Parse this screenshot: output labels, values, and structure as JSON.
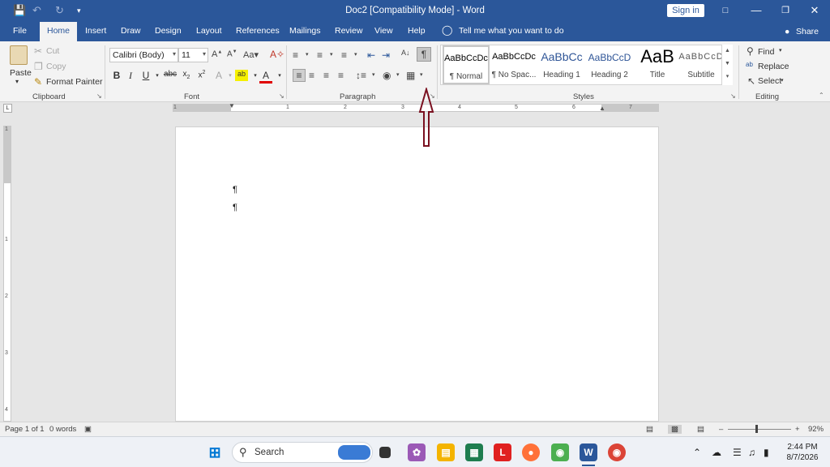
{
  "titlebar": {
    "doc_title": "Doc2 [Compatibility Mode]  -  Word",
    "signin_label": "Sign in"
  },
  "tabs": [
    "File",
    "Home",
    "Insert",
    "Draw",
    "Design",
    "Layout",
    "References",
    "Mailings",
    "Review",
    "View",
    "Help"
  ],
  "tellme": "Tell me what you want to do",
  "share_label": "Share",
  "clipboard": {
    "paste": "Paste",
    "cut": "Cut",
    "copy": "Copy",
    "format_painter": "Format Painter",
    "label": "Clipboard"
  },
  "font": {
    "name": "Calibri (Body)",
    "size": "11",
    "label": "Font"
  },
  "paragraph": {
    "label": "Paragraph"
  },
  "styles": {
    "items": [
      {
        "sample": "AaBbCcDc",
        "name": "¶ Normal"
      },
      {
        "sample": "AaBbCcDc",
        "name": "¶ No Spac..."
      },
      {
        "sample": "AaBbCc",
        "name": "Heading 1"
      },
      {
        "sample": "AaBbCcD",
        "name": "Heading 2"
      },
      {
        "sample": "AaB",
        "name": "Title"
      },
      {
        "sample": "AaBbCcD",
        "name": "Subtitle"
      }
    ],
    "label": "Styles"
  },
  "editing": {
    "find": "Find",
    "replace": "Replace",
    "select": "Select",
    "label": "Editing"
  },
  "ruler_numbers": [
    "1",
    "1",
    "2",
    "3",
    "4",
    "5",
    "6",
    "7"
  ],
  "vruler_numbers": [
    "1",
    "1",
    "2",
    "3",
    "4"
  ],
  "document": {
    "pilcrow": "¶"
  },
  "status": {
    "page": "Page 1 of 1",
    "words": "0 words",
    "zoom": "92%"
  },
  "taskbar": {
    "search": "Search",
    "time": "2:44 PM",
    "date": "8/7/2026"
  },
  "colors": {
    "brand": "#2b579a",
    "annotation": "#7a1020"
  }
}
